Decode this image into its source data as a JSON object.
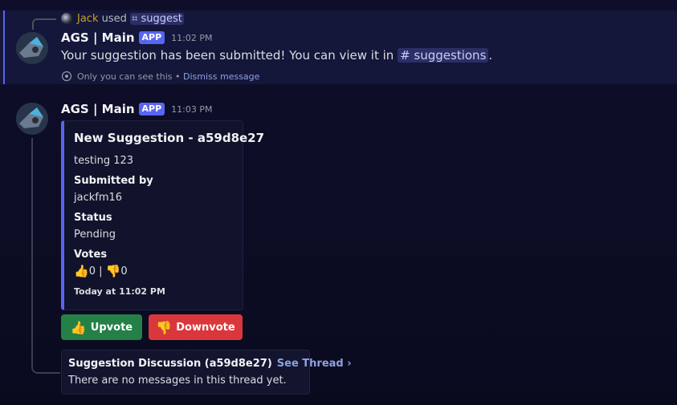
{
  "reply": {
    "user": "Jack",
    "used_text": "used",
    "command": "suggest",
    "command_icon": "slash-command-icon"
  },
  "message1": {
    "author": "AGS | Main",
    "tag": "APP",
    "timestamp": "11:02 PM",
    "text_before": "Your suggestion has been submitted! You can view it in",
    "channel": "suggestions",
    "text_after": ".",
    "ephemeral_note": "Only you can see this",
    "separator": "•",
    "dismiss": "Dismiss message"
  },
  "message2": {
    "author": "AGS | Main",
    "tag": "APP",
    "timestamp": "11:03 PM",
    "embed": {
      "accent_color": "#5865f2",
      "title": "New Suggestion - a59d8e27",
      "description": "testing 123",
      "fields": [
        {
          "name": "Submitted by",
          "value": "jackfm16"
        },
        {
          "name": "Status",
          "value": "Pending"
        },
        {
          "name": "Votes",
          "up_count": "0",
          "separator": "|",
          "down_count": "0"
        }
      ],
      "footer": "Today at 11:02 PM"
    },
    "buttons": {
      "upvote": {
        "label": "Upvote",
        "color": "#248046",
        "icon": "thumbs-up-icon"
      },
      "downvote": {
        "label": "Downvote",
        "color": "#da373c",
        "icon": "thumbs-down-icon"
      }
    },
    "thread": {
      "title": "Suggestion Discussion (a59d8e27)",
      "link": "See Thread",
      "chevron": "›",
      "message": "There are no messages in this thread yet."
    }
  }
}
